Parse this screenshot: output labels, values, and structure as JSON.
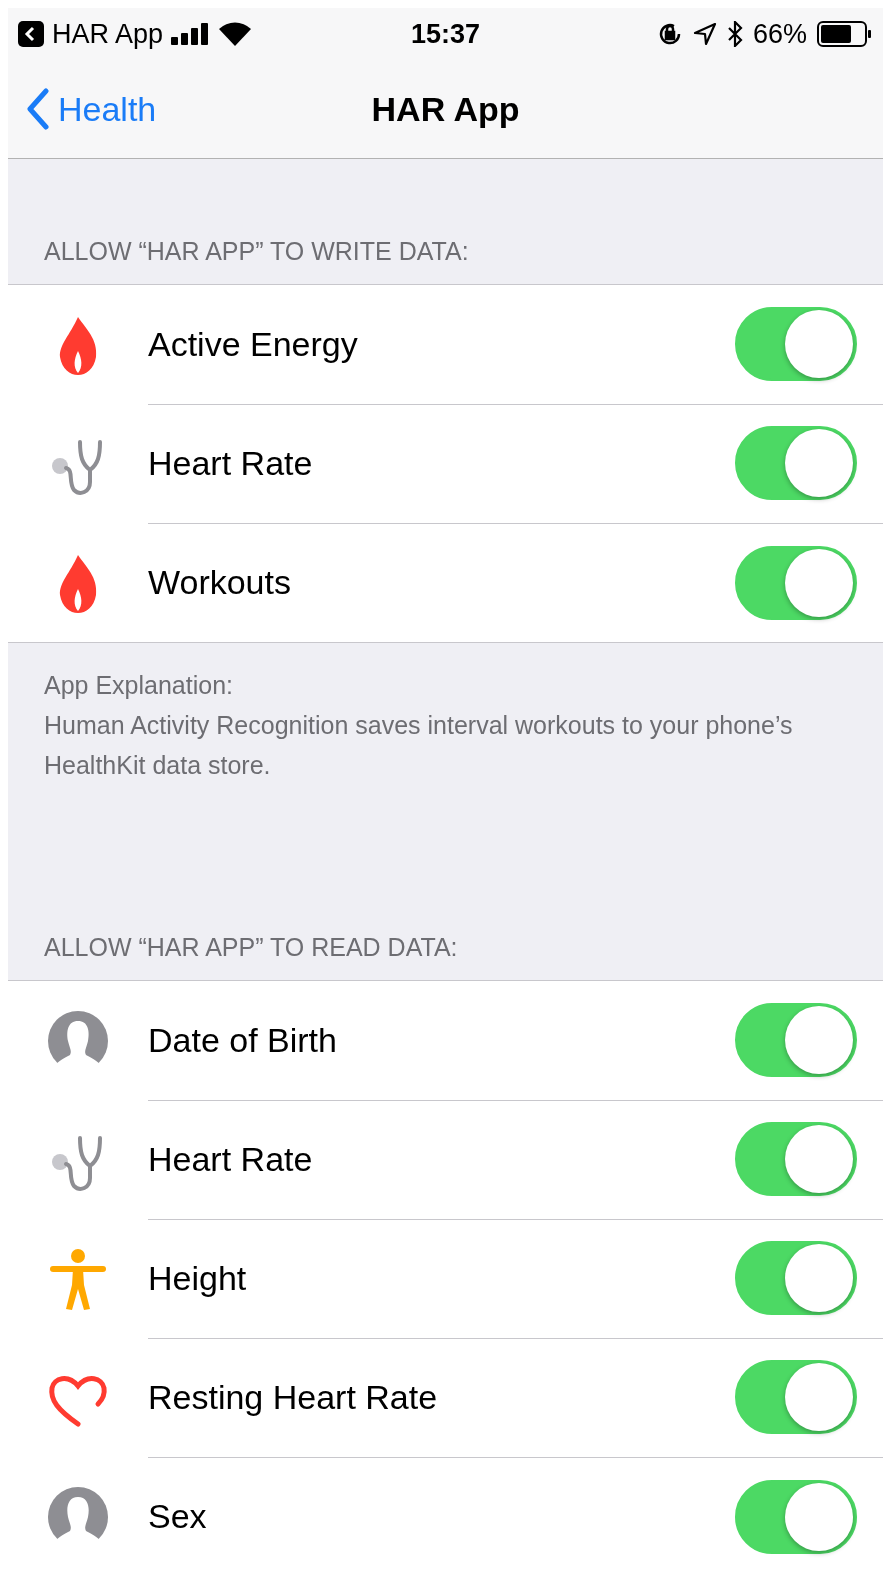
{
  "status_bar": {
    "back_app": "HAR App",
    "time": "15:37",
    "battery": "66%"
  },
  "nav": {
    "back": "Health",
    "title": "HAR App"
  },
  "sections": [
    {
      "header": "ALLOW “HAR APP” TO WRITE DATA:",
      "rows": [
        {
          "kind": "flame",
          "label": "Active Energy",
          "on": true
        },
        {
          "kind": "stethoscope",
          "label": "Heart Rate",
          "on": true
        },
        {
          "kind": "flame",
          "label": "Workouts",
          "on": true
        }
      ],
      "footer": [
        "App Explanation:",
        "Human Activity Recognition saves interval workouts to your phone’s HealthKit data store."
      ]
    },
    {
      "header": "ALLOW “HAR APP” TO READ DATA:",
      "rows": [
        {
          "kind": "person",
          "label": "Date of Birth",
          "on": true
        },
        {
          "kind": "stethoscope",
          "label": "Heart Rate",
          "on": true
        },
        {
          "kind": "figure",
          "label": "Height",
          "on": true
        },
        {
          "kind": "heart",
          "label": "Resting Heart Rate",
          "on": true
        },
        {
          "kind": "person",
          "label": "Sex",
          "on": true
        }
      ]
    }
  ]
}
